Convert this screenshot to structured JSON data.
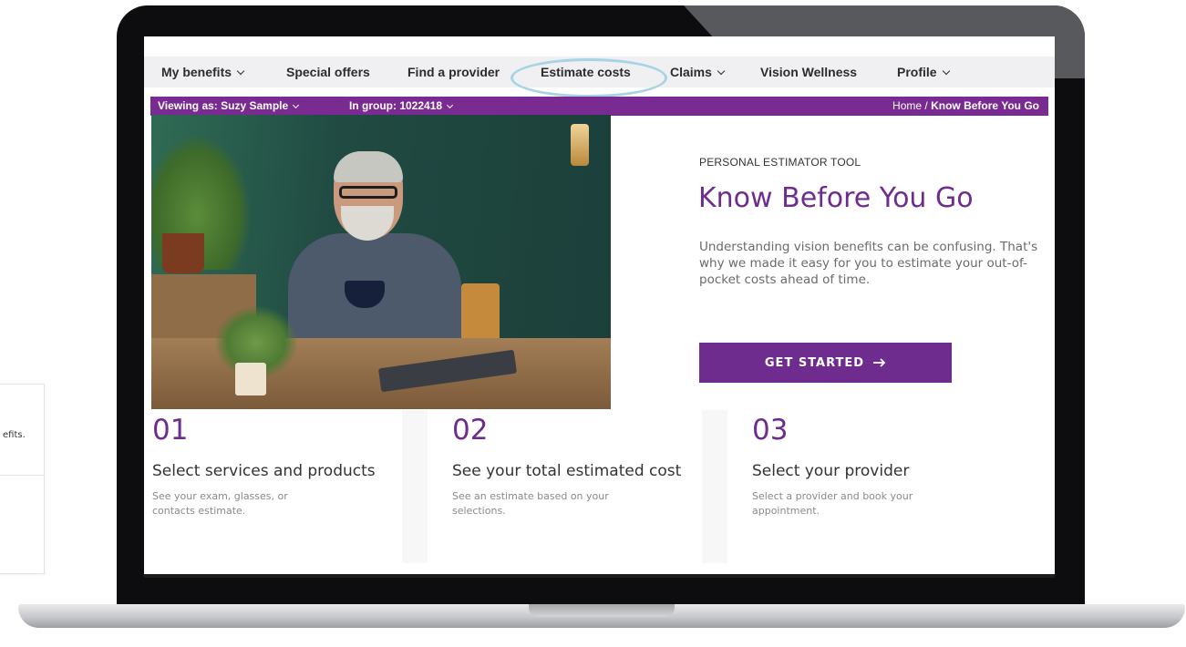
{
  "side_card": {
    "text": "efits."
  },
  "nav": {
    "items": [
      {
        "label": "My benefits",
        "dropdown": true
      },
      {
        "label": "Special offers",
        "dropdown": false
      },
      {
        "label": "Find a provider",
        "dropdown": false
      },
      {
        "label": "Estimate costs",
        "dropdown": false
      },
      {
        "label": "Claims",
        "dropdown": true
      },
      {
        "label": "Vision Wellness",
        "dropdown": false
      },
      {
        "label": "Profile",
        "dropdown": true
      }
    ]
  },
  "context_bar": {
    "viewing_prefix": "Viewing as:",
    "viewing_name": "Suzy Sample",
    "group_prefix": "In group:",
    "group_id": "1022418",
    "breadcrumb_home": "Home",
    "breadcrumb_sep": "/",
    "breadcrumb_current": "Know Before You Go"
  },
  "hero": {
    "eyebrow": "PERSONAL ESTIMATOR TOOL",
    "title": "Know Before You Go",
    "intro": "Understanding vision benefits can be confusing. That's why we made it easy for you to estimate your out-of-pocket costs ahead of time.",
    "cta_label": "GET STARTED",
    "cta_icon": "arrow-right-icon"
  },
  "steps": [
    {
      "number": "01",
      "heading": "Select services and products",
      "description": "See your exam, glasses, or contacts estimate."
    },
    {
      "number": "02",
      "heading": "See your total estimated cost",
      "description": "See an estimate based on your selections."
    },
    {
      "number": "03",
      "heading": "Select your provider",
      "description": "Select a provider and book your appointment."
    }
  ],
  "colors": {
    "brand_purple": "#6e2c8e",
    "context_bar": "#7a2b92",
    "highlight_ring": "#a7d3e4",
    "nav_bg": "#f0f0f2"
  }
}
